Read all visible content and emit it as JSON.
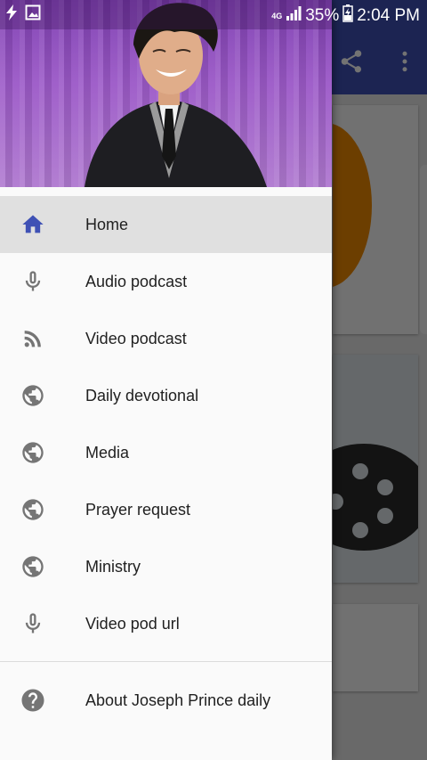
{
  "status_bar": {
    "network_type": "4G",
    "battery": "35%",
    "time": "2:04 PM",
    "icons": [
      "flash-icon",
      "image-icon",
      "signal-icon",
      "battery-icon"
    ]
  },
  "drawer": {
    "header_image": "Joseph Prince portrait on purple stage background",
    "items": [
      {
        "label": "Home",
        "icon": "home-icon",
        "active": true
      },
      {
        "label": "Audio podcast",
        "icon": "microphone-icon",
        "active": false
      },
      {
        "label": "Video podcast",
        "icon": "rss-feed-icon",
        "active": false
      },
      {
        "label": "Daily devotional",
        "icon": "globe-icon",
        "active": false
      },
      {
        "label": "Media",
        "icon": "globe-icon",
        "active": false
      },
      {
        "label": "Prayer request",
        "icon": "globe-icon",
        "active": false
      },
      {
        "label": "Ministry",
        "icon": "globe-icon",
        "active": false
      },
      {
        "label": "Video pod url",
        "icon": "microphone-icon",
        "active": false
      }
    ],
    "footer_item": {
      "label": "About Joseph Prince daily",
      "icon": "help-icon"
    }
  },
  "background": {
    "toolbar_icons": [
      "share-icon",
      "more-vert-icon"
    ]
  },
  "colors": {
    "primary": "#3f51b5",
    "active_icon": "#3f51b5",
    "icon_gray": "#757575",
    "active_row": "#e0e0e0"
  }
}
